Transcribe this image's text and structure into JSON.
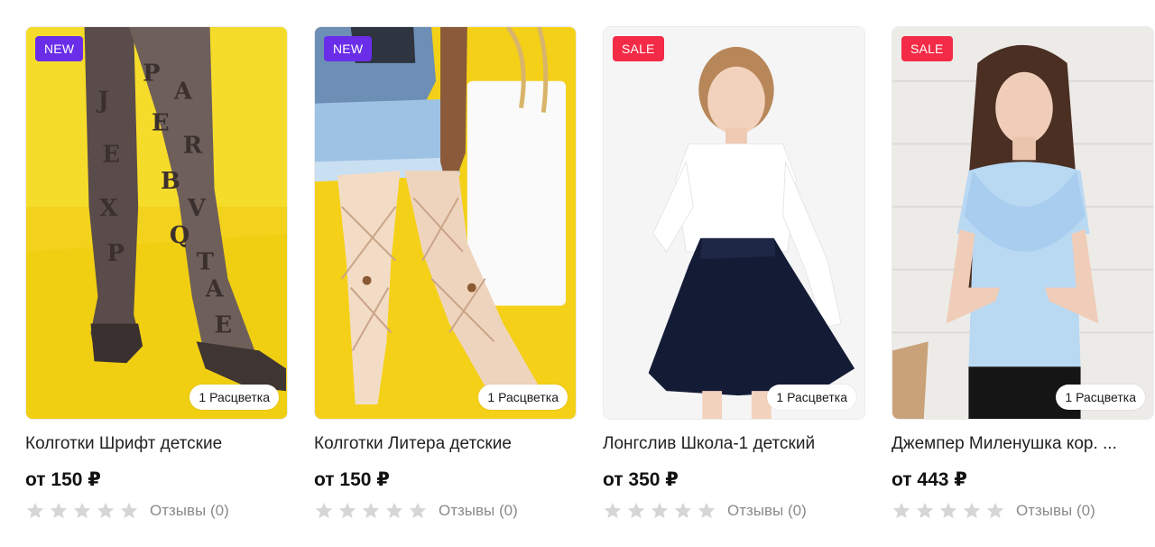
{
  "products": [
    {
      "badge": "NEW",
      "badge_color": "#6a2ee8",
      "variants": "1 Расцветка",
      "title": "Колготки Шрифт детские",
      "price": "от 150 ₽",
      "rating": 0,
      "reviews": "Отзывы (0)"
    },
    {
      "badge": "NEW",
      "badge_color": "#6a2ee8",
      "variants": "1 Расцветка",
      "title": "Колготки Литера детские",
      "price": "от 150 ₽",
      "rating": 0,
      "reviews": "Отзывы (0)"
    },
    {
      "badge": "SALE",
      "badge_color": "#f32b46",
      "variants": "1 Расцветка",
      "title": "Лонгслив Школа-1 детский",
      "price": "от 350 ₽",
      "rating": 0,
      "reviews": "Отзывы (0)"
    },
    {
      "badge": "SALE",
      "badge_color": "#f32b46",
      "variants": "1 Расцветка",
      "title": "Джемпер Миленушка кор. ...",
      "price": "от 443 ₽",
      "rating": 0,
      "reviews": "Отзывы (0)"
    }
  ],
  "colors": {
    "star_empty": "#d6d6d6",
    "review_text": "#8a8a8a"
  }
}
